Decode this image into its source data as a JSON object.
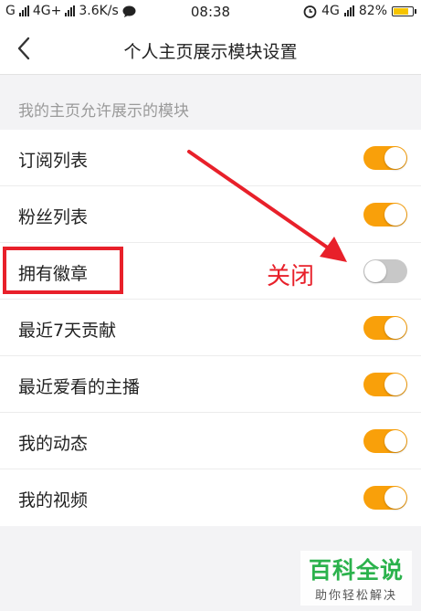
{
  "status_bar": {
    "network_left": "G",
    "network_4g": "4G+",
    "speed": "3.6K/s",
    "time": "08:38",
    "network_right": "4G",
    "battery": "82%",
    "colors": {
      "battery_fill": "#f6c400"
    }
  },
  "nav": {
    "back_icon": "chevron-left-icon",
    "title": "个人主页展示模块设置"
  },
  "section": {
    "header": "我的主页允许展示的模块"
  },
  "items": [
    {
      "label": "订阅列表",
      "enabled": true
    },
    {
      "label": "粉丝列表",
      "enabled": true
    },
    {
      "label": "拥有徽章",
      "enabled": false
    },
    {
      "label": "最近7天贡献",
      "enabled": true
    },
    {
      "label": "最近爱看的主播",
      "enabled": true
    },
    {
      "label": "我的动态",
      "enabled": true
    },
    {
      "label": "我的视频",
      "enabled": true
    }
  ],
  "annotation": {
    "text": "关闭",
    "color": "#e8202a"
  },
  "watermark": {
    "main": "百科全说",
    "sub": "助你轻松解决"
  },
  "colors": {
    "toggle_on": "#f9a00a",
    "toggle_off": "#c8c8c8"
  }
}
